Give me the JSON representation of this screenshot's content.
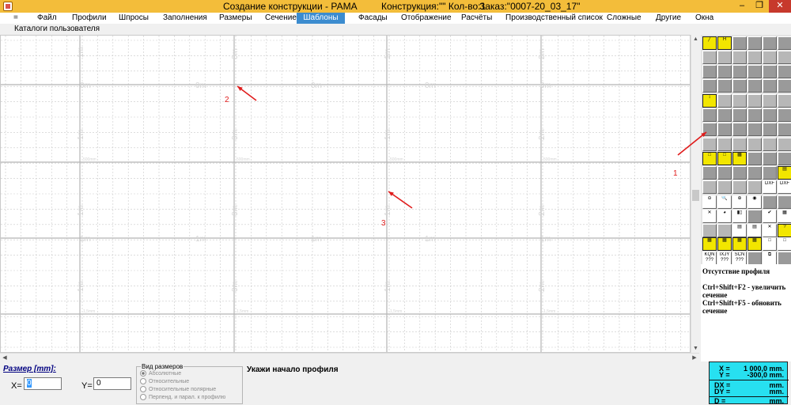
{
  "titlebar": {
    "title": "Создание конструкции - РАМА",
    "construction": "Конструкция:\"\" Кол-во:1",
    "order": "Заказ:\"0007-20_03_17\"",
    "minimize": "–",
    "restore": "❐",
    "close": "✕"
  },
  "menu": {
    "items": [
      "=",
      "Файл",
      "Профили",
      "Шпросы",
      "Заполнения",
      "Размеры",
      "Сечение",
      "Шаблоны",
      "Фасады",
      "Отображение",
      "Расчёты",
      "Производственный список",
      "Сложные",
      "Другие",
      "Окна"
    ],
    "active_index": 7,
    "submenu": "Каталоги пользователя"
  },
  "canvas": {
    "labels_0m": "0m",
    "labels_1m": "1m",
    "labels_2m": "2m",
    "label_500": "500mm",
    "label_1500": "1,5mm",
    "annotations": [
      "1",
      "2",
      "3"
    ],
    "arrow_color": "#e01c1c"
  },
  "palette": {
    "tool_text": {
      "dxf": "DXF",
      "kqn": "KQN ???",
      "ixjy": "IXJY ???",
      "scn": "SCN ???"
    }
  },
  "info": {
    "line1": "Отсутствие профиля",
    "line2": "Ctrl+Shift+F2 - увеличить сечение",
    "line3": "Ctrl+Shift+F5 - обновить сечение"
  },
  "bottom": {
    "razmer_label": "Размер [mm]:",
    "x_label": "X=",
    "x_value": "0",
    "y_label": "Y=",
    "y_value": "0",
    "view_group": "Вид размеров",
    "radios": [
      "Абсолютные",
      "Относительные",
      "Относительные полярные",
      "Перпенд. и парал. к профилю"
    ],
    "radio_selected_index": 0,
    "prompt": "Укажи начало профиля"
  },
  "coords": {
    "x_label": "X =",
    "x_value": "1 000,0  mm.",
    "y_label": "Y =",
    "y_value": "-300,0  mm.",
    "dx_label": "DX =",
    "dx_value": "mm.",
    "dy_label": "DY =",
    "dy_value": "mm.",
    "d_label": "D =",
    "d_value": "mm."
  }
}
